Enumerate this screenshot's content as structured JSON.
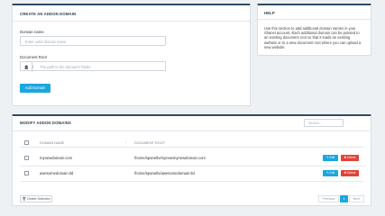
{
  "addon": {
    "title": "Create an Addon Domain",
    "domain_label": "Domain name",
    "domain_placeholder": "Enter valid domain name",
    "docroot_label": "Document Root",
    "docroot_slash": "/",
    "docroot_placeholder": "The path to the domain's folder",
    "submit_label": "Add Domain"
  },
  "help": {
    "title": "Help",
    "text_lines": [
      "Use this section to add additional domain names in your",
      "Shanel account. Each additional domain can be pointed to",
      "an existing document root so that it loads an existing",
      "website or to a new document root where you can upload a",
      "new website."
    ]
  },
  "modify": {
    "title": "Modify Addon Domains",
    "search_placeholder": "Search...",
    "columns": [
      "Domain name",
      "Document root"
    ],
    "sort_indicator": "↓",
    "rows": [
      {
        "domain": "mynewdomain.com",
        "docroot": "/home/spanello/mynewmynewdomain.com",
        "edit": "Edit",
        "delete": "Delete"
      },
      {
        "domain": "awesomedomain.tld",
        "docroot": "/home/spanello/awesomedomain.tld",
        "edit": "Edit",
        "delete": "Delete"
      }
    ],
    "delete_selected": "Delete Selected",
    "pagination": {
      "previous": "Previous",
      "page": "1",
      "next": "Next"
    }
  },
  "colors": {
    "accent": "#1ba6e0",
    "danger": "#e04338",
    "header_bar": "#2e4a66"
  }
}
